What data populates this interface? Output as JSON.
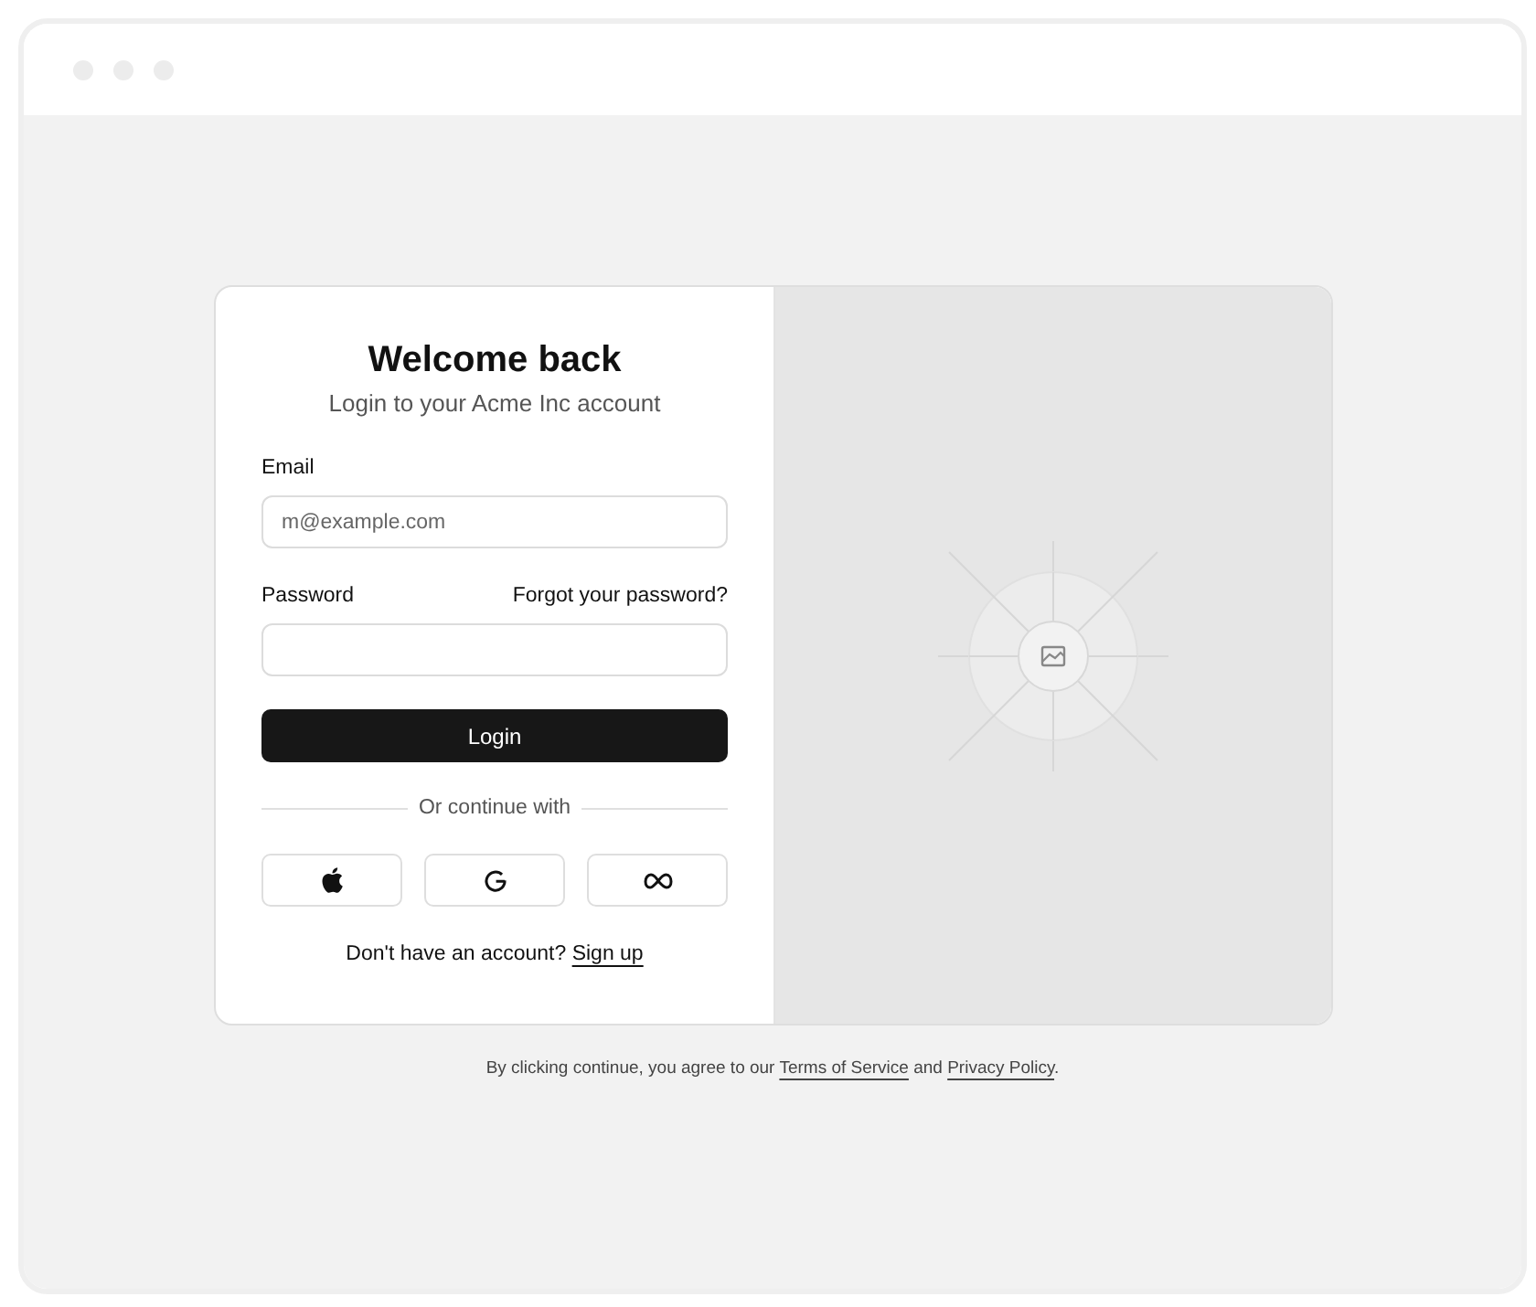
{
  "login": {
    "title": "Welcome back",
    "subtitle": "Login to your Acme Inc account",
    "email": {
      "label": "Email",
      "placeholder": "m@example.com"
    },
    "password": {
      "label": "Password",
      "forgot_link": "Forgot your password?"
    },
    "submit": "Login",
    "divider": "Or continue with",
    "providers": [
      {
        "kind": "apple"
      },
      {
        "kind": "google"
      },
      {
        "kind": "meta"
      }
    ],
    "signup": {
      "prompt": "Don't have an account?",
      "link": "Sign up"
    }
  },
  "footer": {
    "before": "By clicking continue, you agree to our",
    "terms_link": "Terms of Service",
    "middle": "and",
    "privacy_link": "Privacy Policy",
    "end": "."
  }
}
